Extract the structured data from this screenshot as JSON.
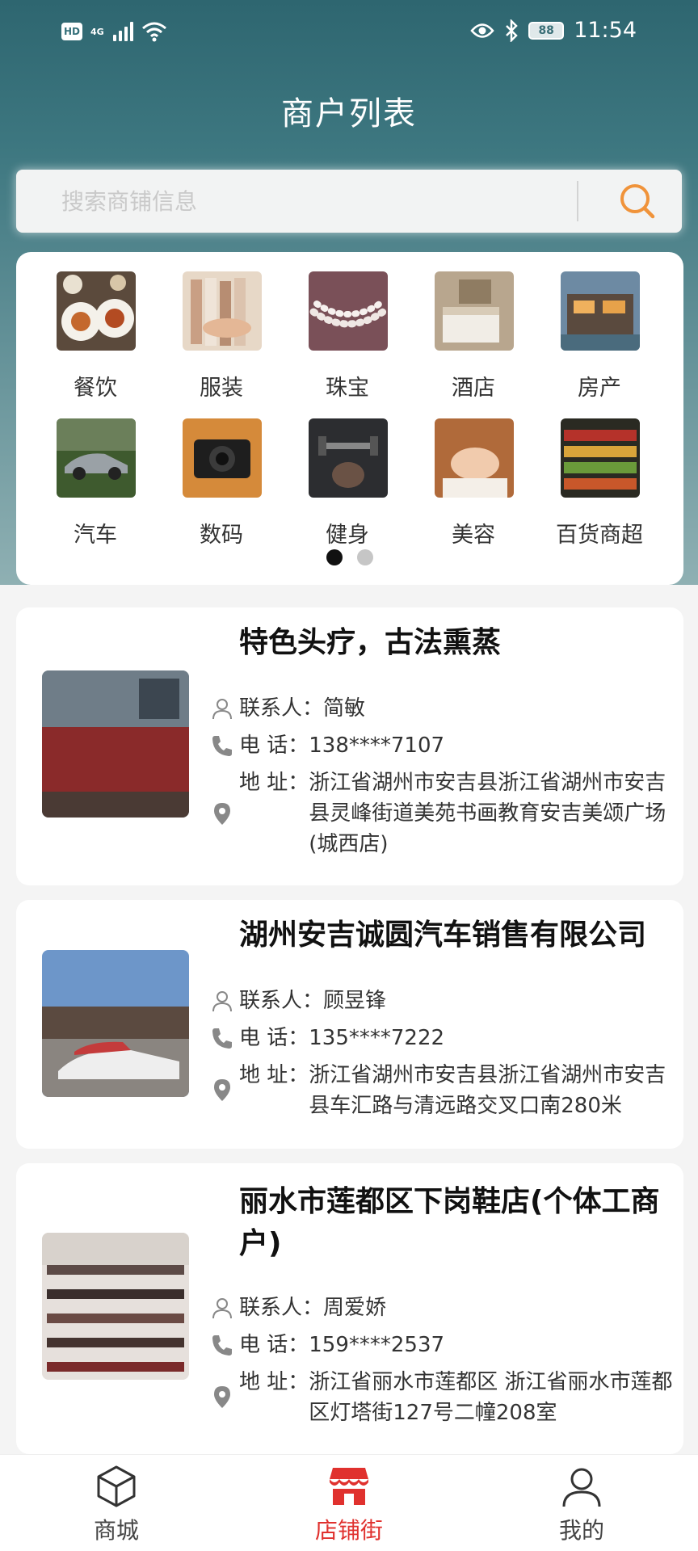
{
  "status_bar": {
    "hd": "HD",
    "network": "4G",
    "battery": "88",
    "time": "11:54"
  },
  "title": "商户列表",
  "search": {
    "placeholder": "搜索商铺信息",
    "icon": "search-icon"
  },
  "categories": [
    {
      "label": "餐饮",
      "icon": "food-image"
    },
    {
      "label": "服装",
      "icon": "clothing-image"
    },
    {
      "label": "珠宝",
      "icon": "jewelry-image"
    },
    {
      "label": "酒店",
      "icon": "hotel-image"
    },
    {
      "label": "房产",
      "icon": "house-image"
    },
    {
      "label": "汽车",
      "icon": "car-image"
    },
    {
      "label": "数码",
      "icon": "camera-image"
    },
    {
      "label": "健身",
      "icon": "fitness-image"
    },
    {
      "label": "美容",
      "icon": "beauty-image"
    },
    {
      "label": "百货商超",
      "icon": "supermarket-image"
    }
  ],
  "pager": {
    "pages": 2,
    "current": 1
  },
  "shops": [
    {
      "name": "特色头疗，古法熏蒸",
      "contact_label": "联系人：",
      "contact": "简敏",
      "phone_label": "电 话：",
      "phone": "138****7107",
      "address_label": "地 址：",
      "address": "浙江省湖州市安吉县浙江省湖州市安吉县灵峰街道美苑书画教育安吉美颂广场(城西店)"
    },
    {
      "name": "湖州安吉诚圆汽车销售有限公司",
      "contact_label": "联系人：",
      "contact": "顾昱锋",
      "phone_label": "电 话：",
      "phone": "135****7222",
      "address_label": "地 址：",
      "address": "浙江省湖州市安吉县浙江省湖州市安吉县车汇路与清远路交叉口南280米"
    },
    {
      "name": "丽水市莲都区下岗鞋店(个体工商户)",
      "contact_label": "联系人：",
      "contact": "周爱娇",
      "phone_label": "电 话：",
      "phone": "159****2537",
      "address_label": "地 址：",
      "address": "浙江省丽水市莲都区 浙江省丽水市莲都区灯塔街127号二幢208室"
    }
  ],
  "tabbar": [
    {
      "label": "商城",
      "icon": "cube-icon",
      "active": false
    },
    {
      "label": "店铺街",
      "icon": "store-icon",
      "active": true
    },
    {
      "label": "我的",
      "icon": "user-icon",
      "active": false
    }
  ],
  "colors": {
    "accent": "#e0312e",
    "search_icon": "#f0933a",
    "header_top": "#2e6670"
  }
}
